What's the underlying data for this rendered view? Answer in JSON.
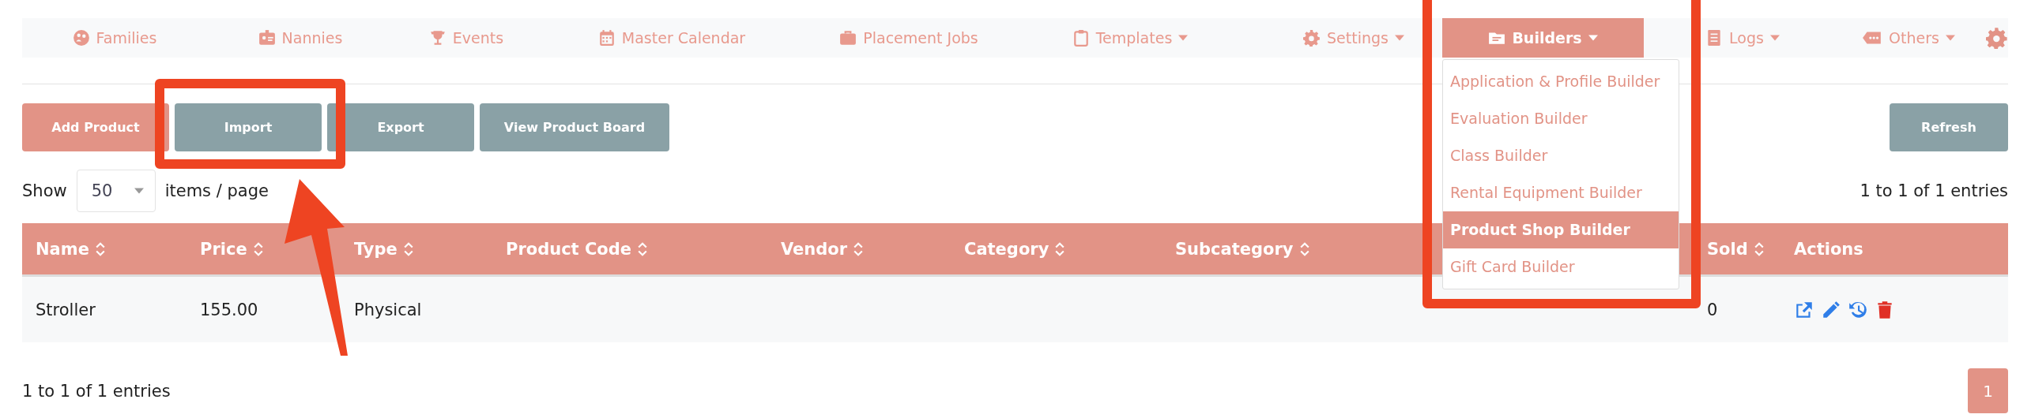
{
  "nav": {
    "items": [
      {
        "label": "Families",
        "has_menu": false,
        "selected": false
      },
      {
        "label": "Nannies",
        "has_menu": false,
        "selected": false
      },
      {
        "label": "Events",
        "has_menu": false,
        "selected": false
      },
      {
        "label": "Master Calendar",
        "has_menu": false,
        "selected": false
      },
      {
        "label": "Placement Jobs",
        "has_menu": false,
        "selected": false
      },
      {
        "label": "Templates",
        "has_menu": true,
        "selected": false
      },
      {
        "label": "Settings",
        "has_menu": true,
        "selected": false
      },
      {
        "label": "Builders",
        "has_menu": true,
        "selected": true,
        "expanded": true,
        "menu": [
          {
            "label": "Application & Profile Builder",
            "selected": false
          },
          {
            "label": "Evaluation Builder",
            "selected": false
          },
          {
            "label": "Class Builder",
            "selected": false
          },
          {
            "label": "Rental Equipment Builder",
            "selected": false
          },
          {
            "label": "Product Shop Builder",
            "selected": true
          },
          {
            "label": "Gift Card Builder",
            "selected": false
          }
        ]
      },
      {
        "label": "Logs",
        "has_menu": true,
        "selected": false
      },
      {
        "label": "Others",
        "has_menu": true,
        "selected": false
      }
    ]
  },
  "toolbar": {
    "buttons": [
      {
        "label": "Add Product",
        "kind": "primary"
      },
      {
        "label": "Import",
        "kind": "secondary"
      },
      {
        "label": "Export",
        "kind": "secondary"
      },
      {
        "label": "View Product Board",
        "kind": "secondary"
      }
    ],
    "refresh": {
      "label": "Refresh",
      "kind": "secondary"
    }
  },
  "page_size": {
    "before": "Show",
    "value": "50",
    "after": "items / page"
  },
  "summary_top": "1 to 1 of 1 entries",
  "table": {
    "columns": [
      {
        "label": "Name",
        "sortable": true
      },
      {
        "label": "Price",
        "sortable": true
      },
      {
        "label": "Type",
        "sortable": true
      },
      {
        "label": "Product Code",
        "sortable": true
      },
      {
        "label": "Vendor",
        "sortable": true
      },
      {
        "label": "Category",
        "sortable": true
      },
      {
        "label": "Subcategory",
        "sortable": true
      },
      {},
      {
        "label": "Sold",
        "sortable": true
      },
      {
        "label": "Actions",
        "sortable": false
      }
    ],
    "rows": [
      {
        "name": "Stroller",
        "price": "155.00",
        "type": "Physical",
        "sold": "0"
      }
    ]
  },
  "summary_bottom": "1 to 1 of 1 entries",
  "pagination": [
    {
      "label": "1",
      "selected": true
    }
  ],
  "annotations": [
    {
      "kind": "box"
    },
    {
      "kind": "box"
    },
    {
      "kind": "arrow"
    }
  ]
}
